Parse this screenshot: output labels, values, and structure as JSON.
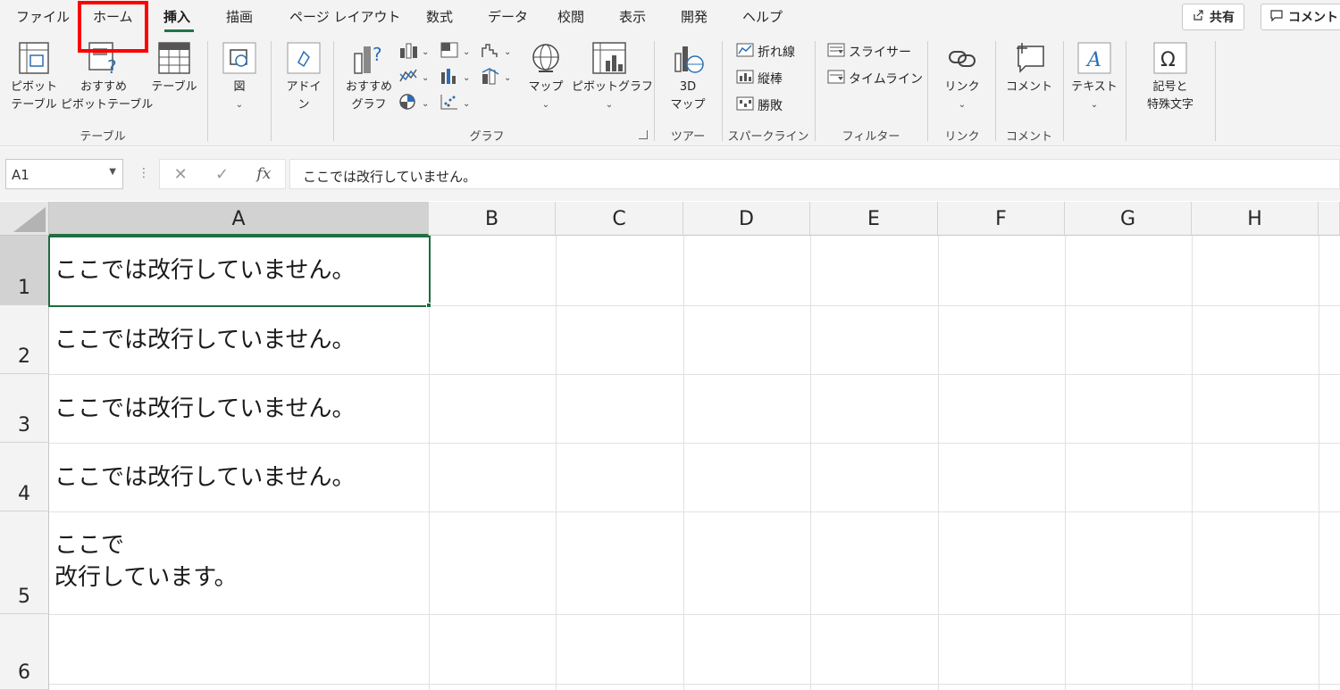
{
  "tabs": [
    "ファイル",
    "ホーム",
    "挿入",
    "描画",
    "ページ レイアウト",
    "数式",
    "データ",
    "校閲",
    "表示",
    "開発",
    "ヘルプ"
  ],
  "active_tab": "挿入",
  "top_buttons": {
    "share": "共有",
    "comment": "コメント"
  },
  "ribbon": {
    "pivot_table": [
      "ピボット",
      "テーブル"
    ],
    "recommended_pivot": [
      "おすすめ",
      "ピボットテーブル"
    ],
    "table": "テーブル",
    "illustrations": "図",
    "addins": [
      "アドイ",
      "ン"
    ],
    "recommended_charts": [
      "おすすめ",
      "グラフ"
    ],
    "maps": "マップ",
    "pivot_chart": "ピボットグラフ",
    "map3d": [
      "3D",
      "マップ"
    ],
    "sparkline_line": "折れ線",
    "sparkline_column": "縦棒",
    "sparkline_winloss": "勝敗",
    "slicer": "スライサー",
    "timeline": "タイムライン",
    "link": "リンク",
    "comment": "コメント",
    "text": "テキスト",
    "symbols": [
      "記号と",
      "特殊文字"
    ],
    "groups": {
      "table": "テーブル",
      "charts": "グラフ",
      "tours": "ツアー",
      "sparklines": "スパークライン",
      "filters": "フィルター",
      "links": "リンク",
      "comments": "コメント"
    }
  },
  "formula_bar": {
    "name_box": "A1",
    "fx": "fx",
    "content": "ここでは改行していません。"
  },
  "columns": [
    "A",
    "B",
    "C",
    "D",
    "E",
    "F",
    "G",
    "H"
  ],
  "rows": [
    "1",
    "2",
    "3",
    "4",
    "5",
    "6"
  ],
  "cells": {
    "A1": "ここでは改行していません。",
    "A2": "ここでは改行していません。",
    "A3": "ここでは改行していません。",
    "A4": "ここでは改行していません。",
    "A5_line1": "ここで",
    "A5_line2": "改行しています。"
  }
}
